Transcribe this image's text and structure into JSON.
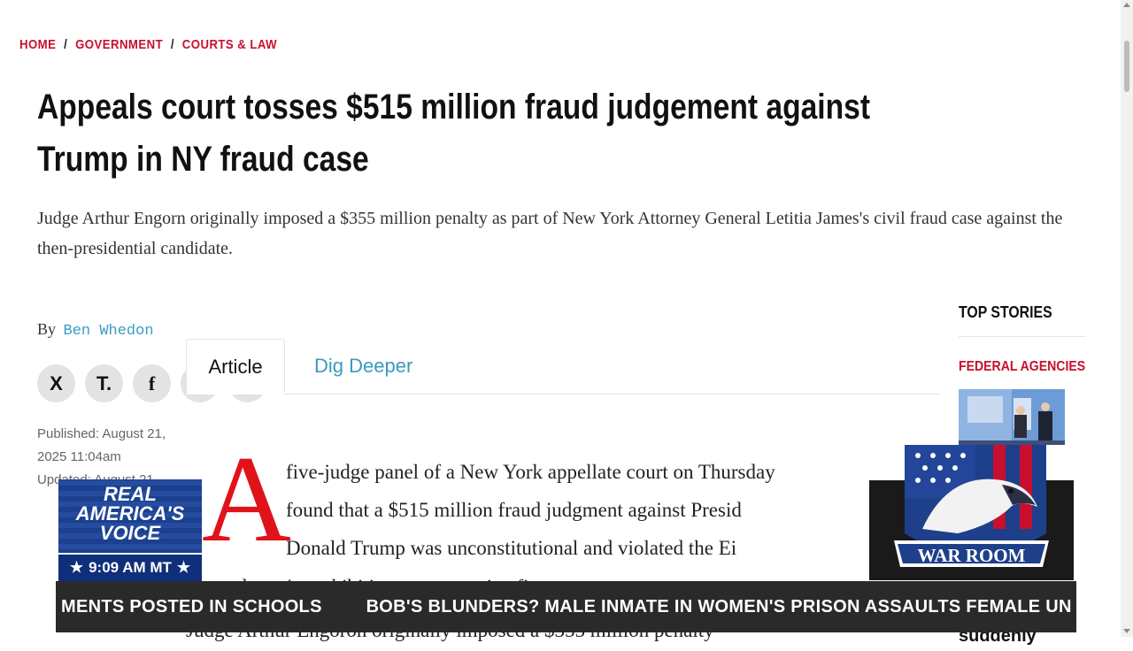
{
  "breadcrumb": {
    "items": [
      "HOME",
      "GOVERNMENT",
      "COURTS & LAW"
    ],
    "separator": "/"
  },
  "article": {
    "headline": "Appeals court tosses $515 million fraud judgement against Trump in NY fraud case",
    "dek": "Judge Arthur Engorn originally imposed a $355 million penalty as part of New York Attorney General Letitia James's civil fraud case against the then-presidential candidate.",
    "byline_prefix": "By",
    "author": "Ben Whedon",
    "published": "Published: August 21, 2025 11:04am",
    "updated": "Updated: August 21,",
    "dropcap": "A",
    "body_lines": [
      "five-judge panel of a New York appellate court on Thursday",
      "found that a $515 million fraud judgment against Presid",
      "Donald Trump was unconstitutional and violated the Ei"
    ],
    "body_continued": "mendment's prohibitions on excessive fines",
    "body_next": "Judge Arthur Engoron originally imposed a $355 million penalty"
  },
  "share": {
    "icons": [
      "x-icon",
      "truth-social-icon",
      "facebook-icon",
      "share-icon",
      "email-icon"
    ],
    "labels": [
      "X",
      "T.",
      "f",
      "",
      ""
    ]
  },
  "tabs": [
    {
      "label": "Article",
      "active": true
    },
    {
      "label": "Dig Deeper",
      "active": false
    }
  ],
  "sidebar": {
    "heading": "TOP STORIES",
    "category": "FEDERAL AGENCIES",
    "story_snippet": "2013 but then suddenly"
  },
  "overlay": {
    "rav_title": "REAL ★ AMERICA'S VOICE",
    "rav_line1": "REAL",
    "rav_line2": "AMERICA'S",
    "rav_line3": "VOICE",
    "rav_time": "9:09 AM MT",
    "warroom_label": "WAR ROOM",
    "ticker": [
      "MENTS POSTED IN SCHOOLS",
      "BOB'S BLUNDERS? MALE INMATE IN WOMEN'S PRISON ASSAULTS FEMALE UN"
    ]
  },
  "colors": {
    "accent_red": "#c8102e",
    "link_blue": "#3a9bc0",
    "rav_blue": "#1c3f8f"
  }
}
